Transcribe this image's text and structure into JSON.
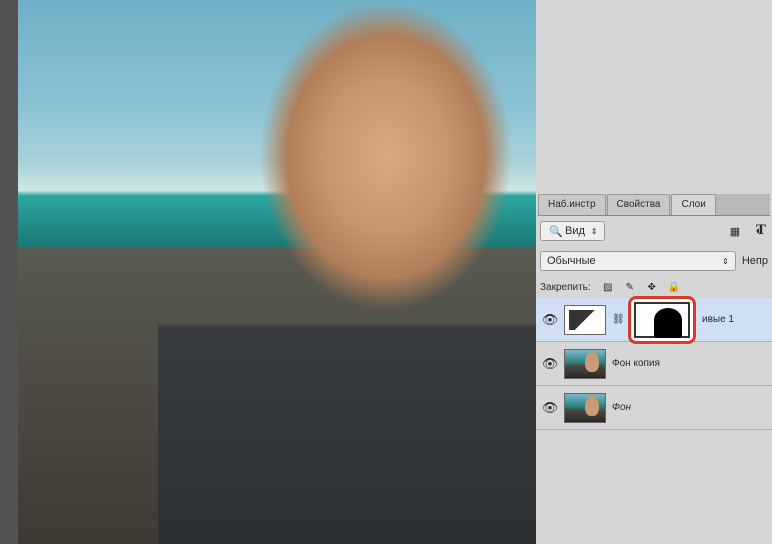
{
  "tabs": {
    "tools": "Наб.инстр",
    "properties": "Свойства",
    "layers": "Слои"
  },
  "filter_row": {
    "kind_label": "Вид"
  },
  "blend_row": {
    "mode": "Обычные",
    "opacity_label": "Непр"
  },
  "lock_row": {
    "label": "Закрепить:"
  },
  "layers": [
    {
      "name": "ивые 1",
      "type": "adjustment",
      "selected": true
    },
    {
      "name": "Фон копия",
      "type": "pixel",
      "selected": false
    },
    {
      "name": "Фон",
      "type": "pixel",
      "selected": false
    }
  ],
  "icons": {
    "eye": "👁",
    "search": "🔍",
    "image": "▦",
    "circle": "◐",
    "text": "T",
    "transparency": "▨",
    "brush": "✎",
    "move": "✥",
    "lock": "🔒",
    "link": "⛓",
    "chevrons": "⇕"
  }
}
